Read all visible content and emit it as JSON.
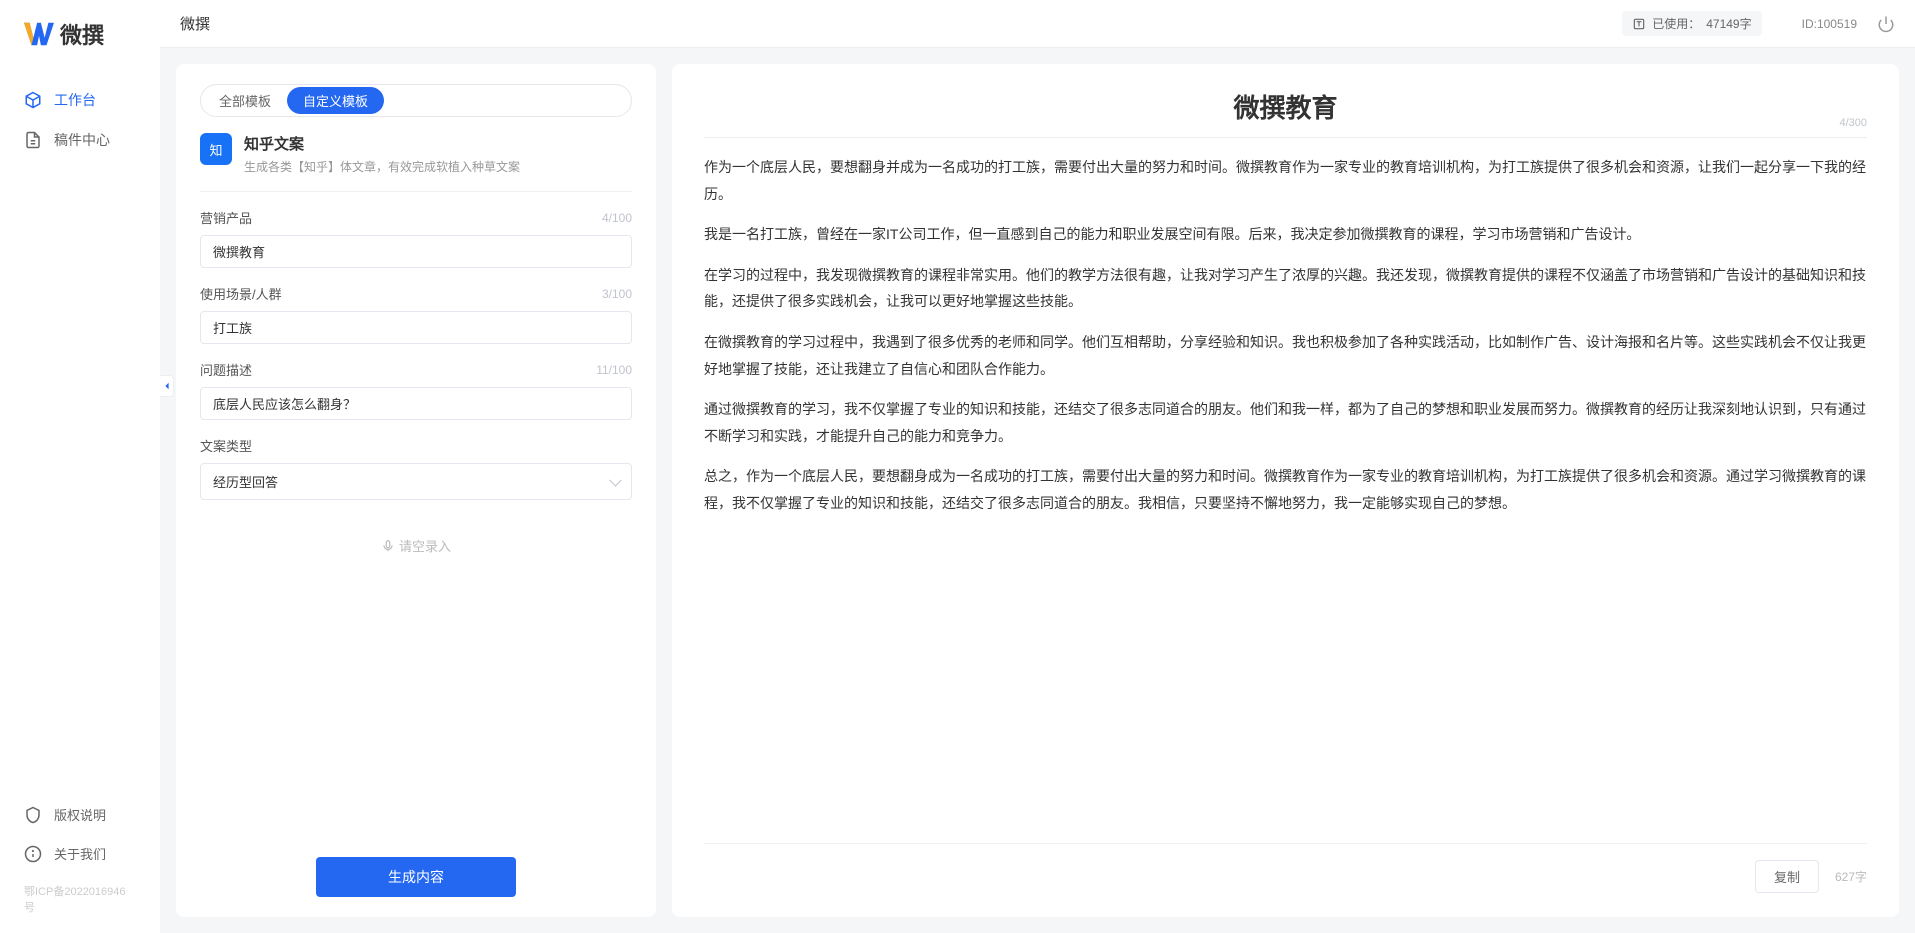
{
  "app": {
    "logo_text": "微撰",
    "topbar_title": "微撰"
  },
  "sidebar": {
    "nav": [
      {
        "label": "工作台",
        "active": true
      },
      {
        "label": "稿件中心",
        "active": false
      }
    ],
    "footer": [
      {
        "label": "版权说明"
      },
      {
        "label": "关于我们"
      }
    ],
    "icp": "鄂ICP备2022016946号"
  },
  "topbar": {
    "usage_prefix": "已使用：",
    "usage_value": "47149字",
    "user_id": "ID:100519"
  },
  "left_panel": {
    "tabs": [
      {
        "label": "全部模板",
        "active": false
      },
      {
        "label": "自定义模板",
        "active": true
      }
    ],
    "template": {
      "icon_text": "知",
      "title": "知乎文案",
      "desc": "生成各类【知乎】体文章，有效完成软植入种草文案"
    },
    "fields": {
      "product": {
        "label": "营销产品",
        "value": "微撰教育",
        "count": "4/100"
      },
      "scene": {
        "label": "使用场景/人群",
        "value": "打工族",
        "count": "3/100"
      },
      "problem": {
        "label": "问题描述",
        "value": "底层人民应该怎么翻身？",
        "count": "11/100"
      },
      "type": {
        "label": "文案类型",
        "value": "经历型回答"
      }
    },
    "voice_hint": "请空录入",
    "generate_btn": "生成内容"
  },
  "right_panel": {
    "title": "微撰教育",
    "title_count": "4/300",
    "paragraphs": [
      "作为一个底层人民，要想翻身并成为一名成功的打工族，需要付出大量的努力和时间。微撰教育作为一家专业的教育培训机构，为打工族提供了很多机会和资源，让我们一起分享一下我的经历。",
      "我是一名打工族，曾经在一家IT公司工作，但一直感到自己的能力和职业发展空间有限。后来，我决定参加微撰教育的课程，学习市场营销和广告设计。",
      "在学习的过程中，我发现微撰教育的课程非常实用。他们的教学方法很有趣，让我对学习产生了浓厚的兴趣。我还发现，微撰教育提供的课程不仅涵盖了市场营销和广告设计的基础知识和技能，还提供了很多实践机会，让我可以更好地掌握这些技能。",
      "在微撰教育的学习过程中，我遇到了很多优秀的老师和同学。他们互相帮助，分享经验和知识。我也积极参加了各种实践活动，比如制作广告、设计海报和名片等。这些实践机会不仅让我更好地掌握了技能，还让我建立了自信心和团队合作能力。",
      "通过微撰教育的学习，我不仅掌握了专业的知识和技能，还结交了很多志同道合的朋友。他们和我一样，都为了自己的梦想和职业发展而努力。微撰教育的经历让我深刻地认识到，只有通过不断学习和实践，才能提升自己的能力和竞争力。",
      "总之，作为一个底层人民，要想翻身成为一名成功的打工族，需要付出大量的努力和时间。微撰教育作为一家专业的教育培训机构，为打工族提供了很多机会和资源。通过学习微撰教育的课程，我不仅掌握了专业的知识和技能，还结交了很多志同道合的朋友。我相信，只要坚持不懈地努力，我一定能够实现自己的梦想。"
    ],
    "copy_btn": "复制",
    "word_count": "627字"
  }
}
